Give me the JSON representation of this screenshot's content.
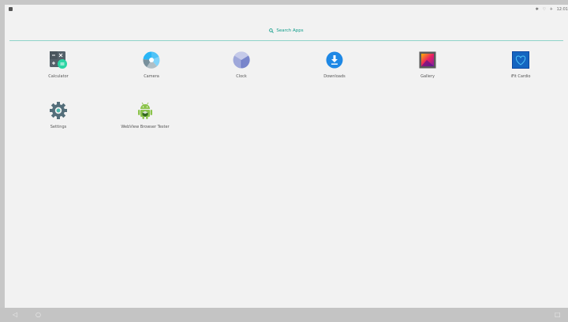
{
  "status_bar": {
    "notification_icon": "sd-card-icon",
    "icons": [
      "bluetooth-icon",
      "wifi-icon",
      "airplane-icon"
    ],
    "time": "12:01"
  },
  "search": {
    "label": "Search Apps",
    "icon": "search-icon",
    "accent_color": "#0f9c8a"
  },
  "apps": [
    {
      "label": "Calculator",
      "icon": "calculator-icon"
    },
    {
      "label": "Camera",
      "icon": "camera-icon"
    },
    {
      "label": "Clock",
      "icon": "clock-icon"
    },
    {
      "label": "Downloads",
      "icon": "downloads-icon"
    },
    {
      "label": "Gallery",
      "icon": "gallery-icon"
    },
    {
      "label": "iFit Cardio",
      "icon": "ifit-cardio-icon"
    },
    {
      "label": "Settings",
      "icon": "settings-icon"
    },
    {
      "label": "WebView Browser Tester",
      "icon": "android-icon"
    }
  ],
  "nav_bar": {
    "back": "back-icon",
    "home": "home-icon",
    "recents": "recents-icon"
  }
}
